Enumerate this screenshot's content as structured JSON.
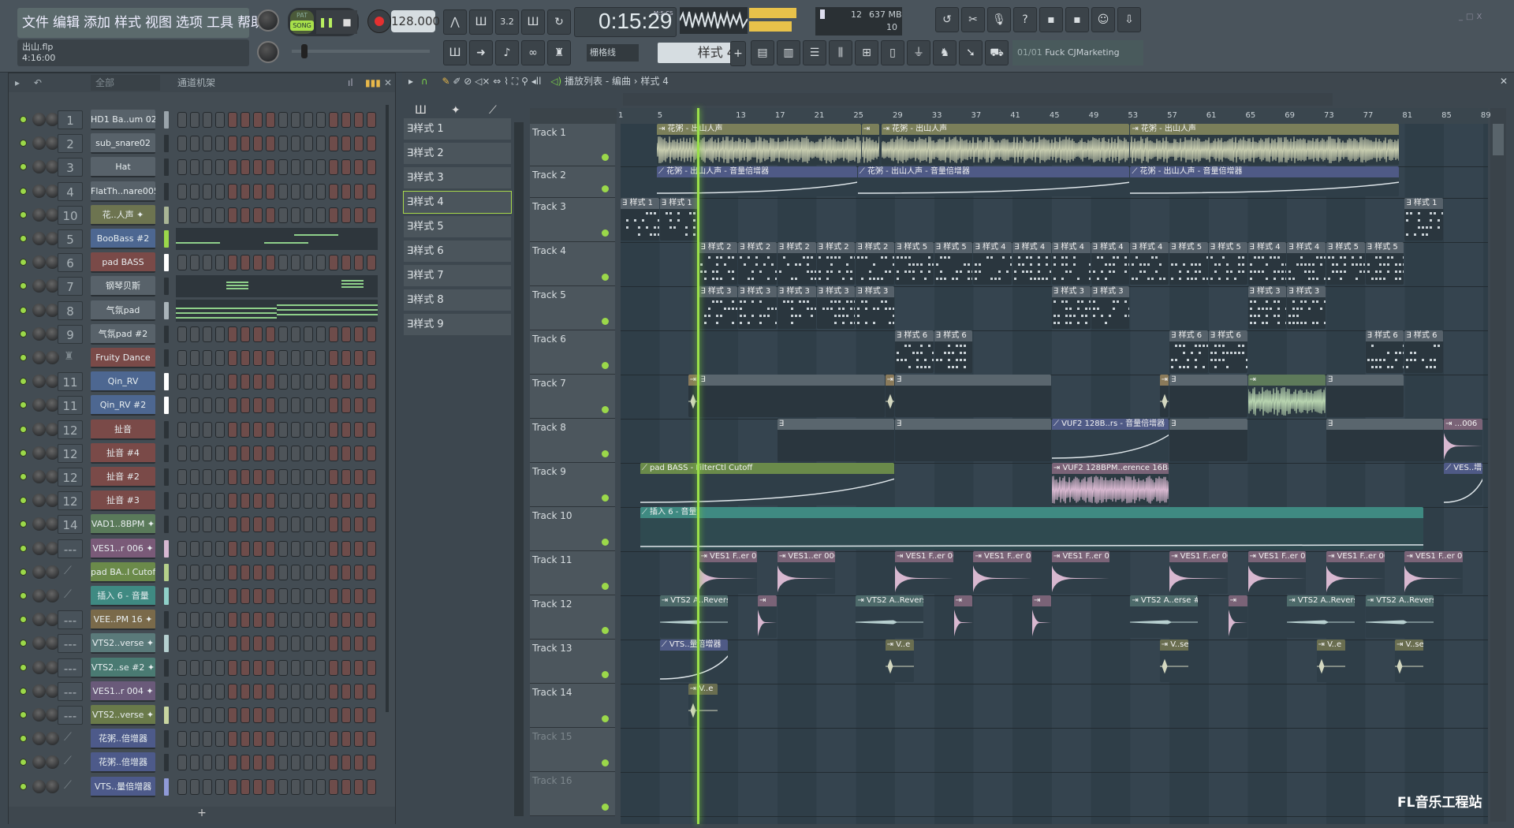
{
  "menu": [
    "文件",
    "编辑",
    "添加",
    "样式",
    "视图",
    "选项",
    "工具",
    "帮助"
  ],
  "hint": {
    "file": "出山.flp",
    "position": "4:16:00"
  },
  "transport": {
    "pat_label": "PAT",
    "song_label": "SONG",
    "mode": "SONG",
    "tempo": "128.000",
    "time": "0:15:29",
    "time_unit": "M:S:CS"
  },
  "monitor": {
    "cpu": "12",
    "memory": "637 MB",
    "polyphony": "10"
  },
  "snap": "栅格线",
  "current_pattern": "样式 4",
  "news": {
    "index": "01/01",
    "text": "Fuck CJMarketing"
  },
  "channel_rack": {
    "filter": "全部",
    "title": "通道机架",
    "add": "+",
    "channels": [
      {
        "num": "1",
        "name": "HD1 Ba..um 027",
        "color": "#58626a",
        "meter": "#9aa4ab",
        "view": "steps"
      },
      {
        "num": "2",
        "name": "sub_snare02",
        "color": "#58626a",
        "meter": "#2c3338",
        "view": "steps"
      },
      {
        "num": "3",
        "name": "Hat",
        "color": "#58626a",
        "meter": "#2c3338",
        "view": "steps"
      },
      {
        "num": "4",
        "name": "FlatTh..nare005",
        "color": "#58626a",
        "meter": "#2c3338",
        "view": "steps"
      },
      {
        "num": "10",
        "name": "花..人声",
        "color": "#6d7450",
        "meter": "#a9b595",
        "view": "steps",
        "audio": true
      },
      {
        "num": "5",
        "name": "BooBass #2",
        "color": "#4d6791",
        "meter": "#9bd84a",
        "view": "roll"
      },
      {
        "num": "6",
        "name": "pad BASS",
        "color": "#7a4a48",
        "meter": "#ffffff",
        "view": "steps"
      },
      {
        "num": "7",
        "name": "钢琴贝斯",
        "color": "#58626a",
        "meter": "#2c3338",
        "view": "roll"
      },
      {
        "num": "8",
        "name": "气氛pad",
        "color": "#58626a",
        "meter": "#aab4ba",
        "view": "roll"
      },
      {
        "num": "9",
        "name": "气氛pad #2",
        "color": "#58626a",
        "meter": "#2c3338",
        "view": "steps"
      },
      {
        "num": "",
        "name": "Fruity Dance",
        "color": "#7a4a48",
        "meter": "#2c3338",
        "view": "steps",
        "fader": true
      },
      {
        "num": "11",
        "name": "Qin_RV",
        "color": "#4d6791",
        "meter": "#ffffff",
        "view": "steps"
      },
      {
        "num": "11",
        "name": "Qin_RV #2",
        "color": "#4d6791",
        "meter": "#ffffff",
        "view": "steps"
      },
      {
        "num": "12",
        "name": "扯音",
        "color": "#7a4a48",
        "meter": "#2c3338",
        "view": "steps"
      },
      {
        "num": "12",
        "name": "扯音 #4",
        "color": "#7a4a48",
        "meter": "#2c3338",
        "view": "steps"
      },
      {
        "num": "12",
        "name": "扯音 #2",
        "color": "#7a4a48",
        "meter": "#2c3338",
        "view": "steps"
      },
      {
        "num": "12",
        "name": "扯音 #3",
        "color": "#7a4a48",
        "meter": "#2c3338",
        "view": "steps"
      },
      {
        "num": "14",
        "name": "VAD1..8BPM",
        "color": "#5a7a5a",
        "meter": "#2c3338",
        "view": "steps",
        "audio": true
      },
      {
        "num": "---",
        "name": "VES1..r 006",
        "color": "#7a5a78",
        "meter": "#d7b8d2",
        "view": "steps",
        "audio": true
      },
      {
        "num": "",
        "name": "pad BA..l Cutoff",
        "color": "#6b8a4a",
        "meter": "#b5d08a",
        "view": "steps",
        "auto": true
      },
      {
        "num": "",
        "name": "插入 6 - 音量",
        "color": "#3f8a82",
        "meter": "#8fd0c8",
        "view": "steps",
        "auto": true
      },
      {
        "num": "---",
        "name": "VEE..PM 16",
        "color": "#7a6a4a",
        "meter": "#2c3338",
        "view": "steps",
        "audio": true
      },
      {
        "num": "---",
        "name": "VTS2..verse",
        "color": "#5a7a7a",
        "meter": "#b5d0d0",
        "view": "steps",
        "audio": true
      },
      {
        "num": "---",
        "name": "VTS2..se #2",
        "color": "#4a7a72",
        "meter": "#2c3338",
        "view": "steps",
        "audio": true
      },
      {
        "num": "---",
        "name": "VES1..r 004",
        "color": "#6a5a7a",
        "meter": "#2c3338",
        "view": "steps",
        "audio": true
      },
      {
        "num": "---",
        "name": "VTS2..verse",
        "color": "#6a7a4a",
        "meter": "#c8d5a0",
        "view": "steps",
        "audio": true
      },
      {
        "num": "",
        "name": "花粥..倍增器",
        "color": "#4d5a8a",
        "meter": "#2c3338",
        "view": "steps",
        "auto": true
      },
      {
        "num": "",
        "name": "花粥..倍增器",
        "color": "#4d5a8a",
        "meter": "#2c3338",
        "view": "steps",
        "auto": true
      },
      {
        "num": "",
        "name": "VTS..量倍增器",
        "color": "#4d5a8a",
        "meter": "#8f9ad8",
        "view": "steps",
        "auto": true
      }
    ]
  },
  "patterns": [
    "样式 1",
    "样式 2",
    "样式 3",
    "样式 4",
    "样式 5",
    "样式 6",
    "样式 7",
    "样式 8",
    "样式 9"
  ],
  "selected_pattern_index": 3,
  "playlist": {
    "title": "播放列表 - 编曲",
    "crumb": "样式 4",
    "playhead_bar": 8.8,
    "ruler": [
      1,
      5,
      13,
      17,
      21,
      25,
      29,
      33,
      37,
      41,
      45,
      49,
      53,
      57,
      61,
      65,
      69,
      73,
      77,
      81,
      85,
      89
    ],
    "tracks": [
      "Track 1",
      "Track 2",
      "Track 3",
      "Track 4",
      "Track 5",
      "Track 6",
      "Track 7",
      "Track 8",
      "Track 9",
      "Track 10",
      "Track 11",
      "Track 12",
      "Track 13",
      "Track 14",
      "Track 15",
      "Track 16"
    ],
    "clips": [
      {
        "t": 0,
        "s": 4.7,
        "e": 25.6,
        "k": "vocal",
        "label": "花粥 - 出山人声"
      },
      {
        "t": 0,
        "s": 25.6,
        "e": 27.5,
        "k": "vocal",
        "label": ""
      },
      {
        "t": 0,
        "s": 27.6,
        "e": 53,
        "k": "vocal",
        "label": "花粥 - 出山人声"
      },
      {
        "t": 0,
        "s": 53,
        "e": 80.5,
        "k": "vocal",
        "label": "花粥 - 出山人声"
      },
      {
        "t": 1,
        "s": 4.7,
        "e": 25.2,
        "k": "auto",
        "label": "花粥 - 出山人声 - 音量倍增器"
      },
      {
        "t": 1,
        "s": 25.2,
        "e": 53,
        "k": "auto",
        "label": "花粥 - 出山人声 - 音量倍增器"
      },
      {
        "t": 1,
        "s": 53,
        "e": 80.5,
        "k": "auto",
        "label": "花粥 - 出山人声 - 音量倍增器"
      },
      {
        "t": 2,
        "s": 1,
        "e": 5,
        "k": "pat",
        "label": "样式 1"
      },
      {
        "t": 2,
        "s": 5,
        "e": 9,
        "k": "pat",
        "label": "样式 1"
      },
      {
        "t": 2,
        "s": 81,
        "e": 85,
        "k": "pat",
        "label": "样式 1"
      },
      {
        "t": 3,
        "s": 9,
        "e": 13,
        "k": "pat",
        "label": "样式 2"
      },
      {
        "t": 3,
        "s": 13,
        "e": 17,
        "k": "pat",
        "label": "样式 2"
      },
      {
        "t": 3,
        "s": 17,
        "e": 21,
        "k": "pat",
        "label": "样式 2"
      },
      {
        "t": 3,
        "s": 21,
        "e": 25,
        "k": "pat",
        "label": "样式 2"
      },
      {
        "t": 3,
        "s": 25,
        "e": 29,
        "k": "pat",
        "label": "样式 2"
      },
      {
        "t": 3,
        "s": 29,
        "e": 33,
        "k": "pat",
        "label": "样式 5"
      },
      {
        "t": 3,
        "s": 33,
        "e": 37,
        "k": "pat",
        "label": "样式 5"
      },
      {
        "t": 3,
        "s": 37,
        "e": 41,
        "k": "pat",
        "label": "样式 4"
      },
      {
        "t": 3,
        "s": 41,
        "e": 45,
        "k": "pat",
        "label": "样式 4"
      },
      {
        "t": 3,
        "s": 45,
        "e": 49,
        "k": "pat",
        "label": "样式 4"
      },
      {
        "t": 3,
        "s": 49,
        "e": 53,
        "k": "pat",
        "label": "样式 4"
      },
      {
        "t": 3,
        "s": 53,
        "e": 57,
        "k": "pat",
        "label": "样式 4"
      },
      {
        "t": 3,
        "s": 57,
        "e": 61,
        "k": "pat",
        "label": "样式 5"
      },
      {
        "t": 3,
        "s": 61,
        "e": 65,
        "k": "pat",
        "label": "样式 5"
      },
      {
        "t": 3,
        "s": 65,
        "e": 69,
        "k": "pat",
        "label": "样式 4"
      },
      {
        "t": 3,
        "s": 69,
        "e": 73,
        "k": "pat",
        "label": "样式 4"
      },
      {
        "t": 3,
        "s": 73,
        "e": 77,
        "k": "pat",
        "label": "样式 5"
      },
      {
        "t": 3,
        "s": 77,
        "e": 81,
        "k": "pat",
        "label": "样式 5"
      },
      {
        "t": 4,
        "s": 9,
        "e": 13,
        "k": "pat",
        "label": "样式 3"
      },
      {
        "t": 4,
        "s": 13,
        "e": 17,
        "k": "pat",
        "label": "样式 3"
      },
      {
        "t": 4,
        "s": 17,
        "e": 21,
        "k": "pat",
        "label": "样式 3"
      },
      {
        "t": 4,
        "s": 21,
        "e": 25,
        "k": "pat",
        "label": "样式 3"
      },
      {
        "t": 4,
        "s": 25,
        "e": 29,
        "k": "pat",
        "label": "样式 3"
      },
      {
        "t": 4,
        "s": 45,
        "e": 49,
        "k": "pat",
        "label": "样式 3"
      },
      {
        "t": 4,
        "s": 49,
        "e": 53,
        "k": "pat",
        "label": "样式 3"
      },
      {
        "t": 4,
        "s": 65,
        "e": 69,
        "k": "pat",
        "label": "样式 3"
      },
      {
        "t": 4,
        "s": 69,
        "e": 73,
        "k": "pat",
        "label": "样式 3"
      },
      {
        "t": 5,
        "s": 29,
        "e": 33,
        "k": "pat",
        "label": "样式 6"
      },
      {
        "t": 5,
        "s": 33,
        "e": 37,
        "k": "pat",
        "label": "样式 6"
      },
      {
        "t": 5,
        "s": 57,
        "e": 61,
        "k": "pat",
        "label": "样式 6"
      },
      {
        "t": 5,
        "s": 61,
        "e": 65,
        "k": "pat",
        "label": "样式 6"
      },
      {
        "t": 5,
        "s": 77,
        "e": 81,
        "k": "pat",
        "label": "样式 6"
      },
      {
        "t": 5,
        "s": 81,
        "e": 85,
        "k": "pat",
        "label": "样式 6"
      },
      {
        "t": 6,
        "s": 7.9,
        "e": 9,
        "k": "hit",
        "label": ""
      },
      {
        "t": 6,
        "s": 9,
        "e": 28,
        "k": "strip",
        "label": ""
      },
      {
        "t": 6,
        "s": 28,
        "e": 29,
        "k": "hit",
        "label": ""
      },
      {
        "t": 6,
        "s": 29,
        "e": 45,
        "k": "strip",
        "label": ""
      },
      {
        "t": 6,
        "s": 56,
        "e": 57,
        "k": "hit",
        "label": ""
      },
      {
        "t": 6,
        "s": 57,
        "e": 65,
        "k": "strip",
        "label": ""
      },
      {
        "t": 6,
        "s": 65,
        "e": 73,
        "k": "green",
        "label": ""
      },
      {
        "t": 6,
        "s": 73,
        "e": 81,
        "k": "strip",
        "label": ""
      },
      {
        "t": 7,
        "s": 17,
        "e": 29,
        "k": "strip",
        "label": ""
      },
      {
        "t": 7,
        "s": 29,
        "e": 45,
        "k": "strip",
        "label": ""
      },
      {
        "t": 7,
        "s": 45,
        "e": 57,
        "k": "auto",
        "label": "VUF2 128B..rs - 音量倍增器"
      },
      {
        "t": 7,
        "s": 57,
        "e": 65,
        "k": "strip",
        "label": ""
      },
      {
        "t": 7,
        "s": 73,
        "e": 85,
        "k": "strip",
        "label": ""
      },
      {
        "t": 7,
        "s": 85,
        "e": 89,
        "k": "pink",
        "label": "...006"
      },
      {
        "t": 8,
        "s": 3,
        "e": 29,
        "k": "autog",
        "label": "pad BASS - FilterCtl Cutoff"
      },
      {
        "t": 8,
        "s": 45,
        "e": 57,
        "k": "pinkw",
        "label": "VUF2 128BPM..erence 16Bars"
      },
      {
        "t": 8,
        "s": 85,
        "e": 89,
        "k": "auto",
        "label": "VES..增器"
      },
      {
        "t": 9,
        "s": 3,
        "e": 83,
        "k": "autot",
        "label": "插入 6 - 音量"
      },
      {
        "t": 10,
        "s": 9,
        "e": 15,
        "k": "pink",
        "label": "VES1 F..er 006"
      },
      {
        "t": 10,
        "s": 17,
        "e": 23,
        "k": "pink",
        "label": "VES1..er 006"
      },
      {
        "t": 10,
        "s": 29,
        "e": 35,
        "k": "pink",
        "label": "VES1 F..er 006"
      },
      {
        "t": 10,
        "s": 37,
        "e": 43,
        "k": "pink",
        "label": "VES1 F..er 006"
      },
      {
        "t": 10,
        "s": 45,
        "e": 51,
        "k": "pink",
        "label": "VES1 F..er 006"
      },
      {
        "t": 10,
        "s": 57,
        "e": 63,
        "k": "pink",
        "label": "VES1 F..er 006"
      },
      {
        "t": 10,
        "s": 65,
        "e": 71,
        "k": "pink",
        "label": "VES1 F..er 006"
      },
      {
        "t": 10,
        "s": 73,
        "e": 79,
        "k": "pink",
        "label": "VES1 F..er 006"
      },
      {
        "t": 10,
        "s": 81,
        "e": 87,
        "k": "pink",
        "label": "VES1 F..er 006"
      },
      {
        "t": 11,
        "s": 5,
        "e": 12,
        "k": "teal",
        "label": "VTS2 A..Reverse"
      },
      {
        "t": 11,
        "s": 15,
        "e": 17,
        "k": "pinks",
        "label": ""
      },
      {
        "t": 11,
        "s": 25,
        "e": 32,
        "k": "teal",
        "label": "VTS2 A..Reverse"
      },
      {
        "t": 11,
        "s": 35,
        "e": 37,
        "k": "pinks",
        "label": ""
      },
      {
        "t": 11,
        "s": 43,
        "e": 45,
        "k": "pinks",
        "label": ""
      },
      {
        "t": 11,
        "s": 53,
        "e": 60,
        "k": "teal",
        "label": "VTS2 A..erse #2"
      },
      {
        "t": 11,
        "s": 63,
        "e": 65,
        "k": "pinks",
        "label": ""
      },
      {
        "t": 11,
        "s": 69,
        "e": 76,
        "k": "teal",
        "label": "VTS2 A..Reverse"
      },
      {
        "t": 11,
        "s": 77,
        "e": 84,
        "k": "teal",
        "label": "VTS2 A..Reverse"
      },
      {
        "t": 12,
        "s": 5,
        "e": 12,
        "k": "auto",
        "label": "VTS..量倍增器"
      },
      {
        "t": 12,
        "s": 28,
        "e": 31,
        "k": "olive",
        "label": "V..e"
      },
      {
        "t": 12,
        "s": 56,
        "e": 59,
        "k": "olive",
        "label": "V..se"
      },
      {
        "t": 12,
        "s": 72,
        "e": 75,
        "k": "olive",
        "label": "V..e"
      },
      {
        "t": 12,
        "s": 80,
        "e": 83,
        "k": "olive",
        "label": "V..se"
      },
      {
        "t": 13,
        "s": 7.9,
        "e": 11,
        "k": "olive",
        "label": "V..e"
      }
    ]
  },
  "watermark": "FL音乐工程站"
}
